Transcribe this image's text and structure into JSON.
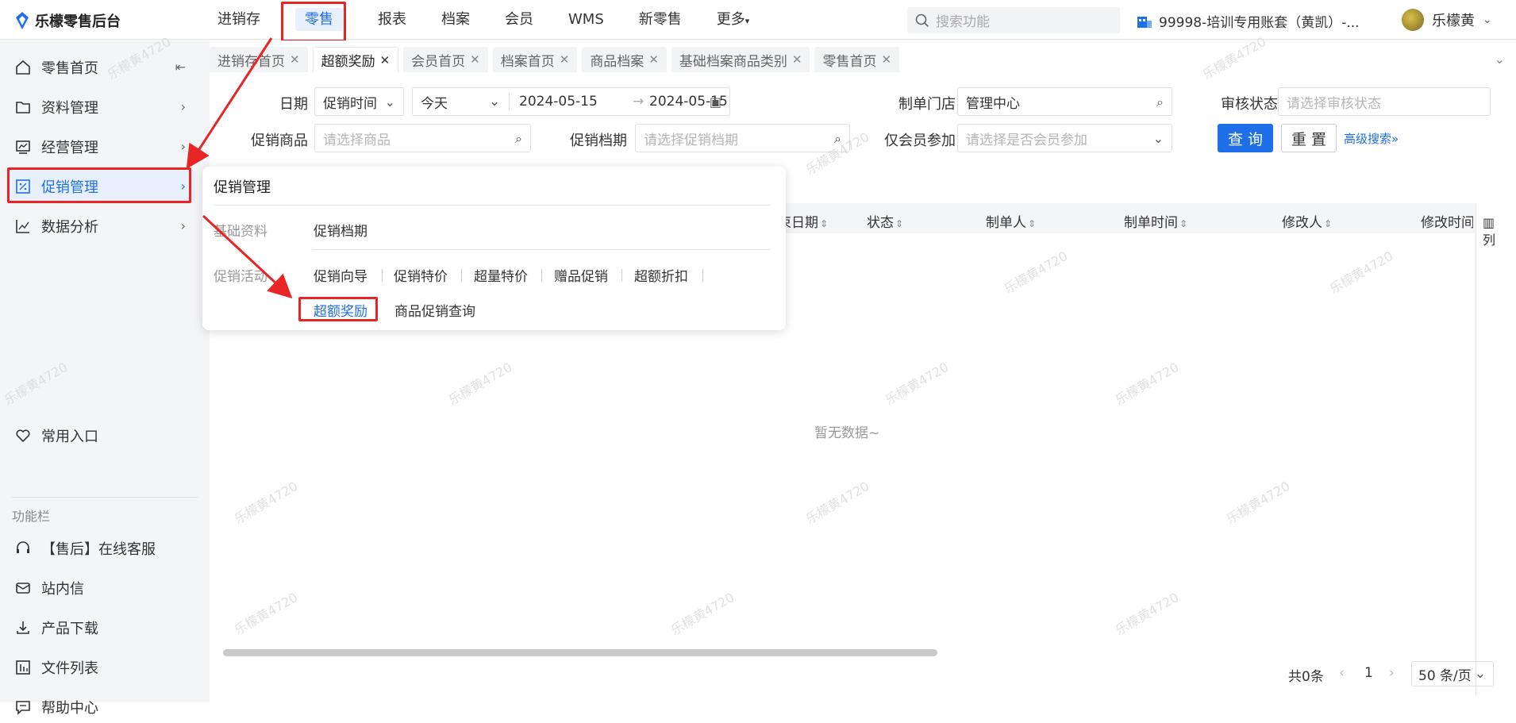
{
  "app": {
    "title": "乐檬零售后台"
  },
  "nav": {
    "items": [
      "进销存",
      "零售",
      "报表",
      "档案",
      "会员",
      "WMS",
      "新零售",
      "更多"
    ]
  },
  "search": {
    "placeholder": "搜索功能"
  },
  "account": {
    "label": "99998-培训专用账套（黄凯）-..."
  },
  "user": {
    "name": "乐檬黄"
  },
  "sidebar": {
    "items": [
      {
        "label": "零售首页",
        "icon": "home-icon"
      },
      {
        "label": "资料管理",
        "icon": "folder-icon"
      },
      {
        "label": "经营管理",
        "icon": "trend-board-icon"
      },
      {
        "label": "促销管理",
        "icon": "percent-tag-icon"
      },
      {
        "label": "数据分析",
        "icon": "line-chart-icon"
      }
    ],
    "favorites": "常用入口",
    "section_label": "功能栏",
    "tools": [
      {
        "label": "【售后】在线客服",
        "icon": "headset-icon"
      },
      {
        "label": "站内信",
        "icon": "mail-icon"
      },
      {
        "label": "产品下载",
        "icon": "download-icon"
      },
      {
        "label": "文件列表",
        "icon": "file-list-icon"
      },
      {
        "label": "帮助中心",
        "icon": "help-chat-icon"
      }
    ]
  },
  "tabs": [
    "进销存首页",
    "超额奖励",
    "会员首页",
    "档案首页",
    "商品档案",
    "基础档案商品类别",
    "零售首页"
  ],
  "filters": {
    "date_label": "日期",
    "date_type": "促销时间",
    "date_range": "今天",
    "date_start": "2024-05-15",
    "date_sep": "→",
    "date_end": "2024-05-15",
    "store_label": "制单门店",
    "store_value": "管理中心",
    "audit_label": "审核状态",
    "audit_placeholder": "请选择审核状态",
    "goods_label": "促销商品",
    "goods_placeholder": "请选择商品",
    "schedule_label": "促销档期",
    "schedule_placeholder": "请选择促销档期",
    "member_label": "仅会员参加",
    "member_placeholder": "请选择是否会员参加",
    "query_button": "查 询",
    "reset_button": "重 置",
    "advanced": "高级搜索"
  },
  "table": {
    "columns": [
      "束日期",
      "状态",
      "制单人",
      "制单时间",
      "修改人",
      "修改时间"
    ],
    "column_settings": "列",
    "empty_text": "暂无数据~"
  },
  "pagination": {
    "total": "共0条",
    "page": "1",
    "page_size": "50 条/页"
  },
  "popover": {
    "title": "促销管理",
    "basic_label": "基础资料",
    "basic_items": [
      "促销档期"
    ],
    "activity_label": "促销活动",
    "activity_items": [
      "促销向导",
      "促销特价",
      "超量特价",
      "赠品促销",
      "超额折扣",
      "超额奖励",
      "商品促销查询"
    ]
  },
  "watermark": "乐檬黄4720",
  "colors": {
    "accent": "#1e6fe8",
    "highlight": "#e82525"
  }
}
